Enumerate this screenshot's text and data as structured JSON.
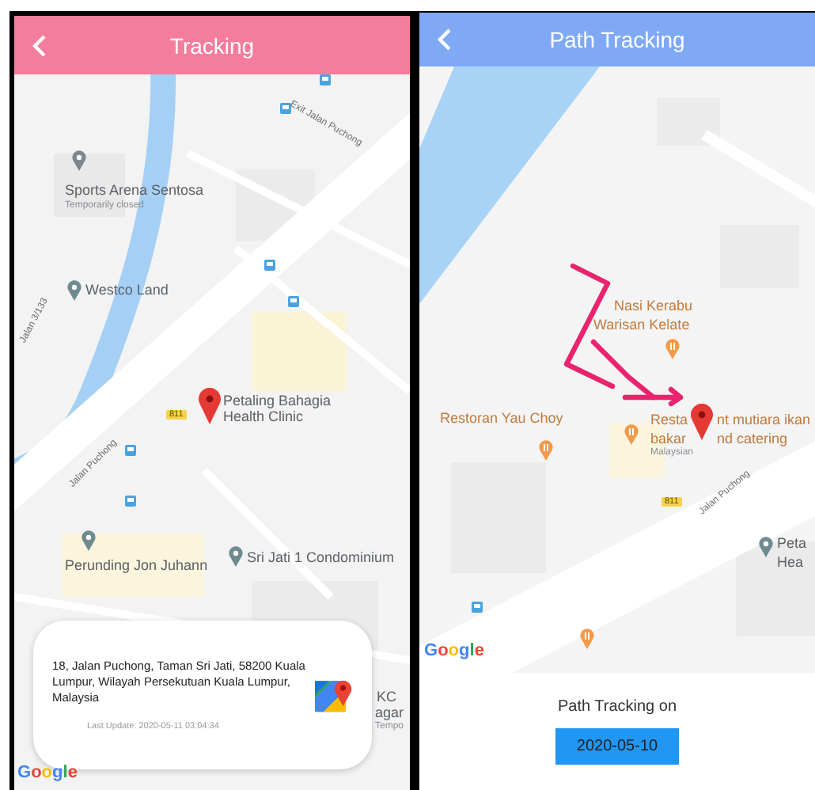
{
  "tracking_screen": {
    "header": {
      "title": "Tracking"
    },
    "map": {
      "labels": [
        {
          "text": "Exit Jalan Puchong",
          "kind": "street"
        },
        {
          "text": "Sports Arena Sentosa",
          "kind": "place"
        },
        {
          "text": "Temporarily closed",
          "kind": "note"
        },
        {
          "text": "Westco Land",
          "kind": "place"
        },
        {
          "text": "Jalan 3/133",
          "kind": "street"
        },
        {
          "text": "811",
          "kind": "shield"
        },
        {
          "text": "Petaling Bahagia Health Clinic",
          "kind": "place"
        },
        {
          "text": "Jalan Puchong",
          "kind": "street"
        },
        {
          "text": "Perunding Jon Juhann",
          "kind": "place"
        },
        {
          "text": "Sri Jati 1 Condominium",
          "kind": "place"
        },
        {
          "text": "KC",
          "kind": "place"
        },
        {
          "text": "agar",
          "kind": "place"
        },
        {
          "text": "Tempo",
          "kind": "note"
        }
      ],
      "attribution": "Google"
    },
    "address_card": {
      "address": "18, Jalan Puchong, Taman Sri Jati, 58200 Kuala Lumpur, Wilayah Persekutuan Kuala Lumpur, Malaysia",
      "last_update": "Last Update: 2020-05-11 03:04:34"
    }
  },
  "path_tracking_screen": {
    "header": {
      "title": "Path Tracking"
    },
    "map": {
      "labels": [
        {
          "text": "Nasi Kerabu",
          "kind": "food"
        },
        {
          "text": "Warisan Kelate",
          "kind": "food"
        },
        {
          "text": "Restoran Yau Choy",
          "kind": "food"
        },
        {
          "text": "Resta",
          "kind": "food"
        },
        {
          "text": "nt mutiara ikan",
          "kind": "food"
        },
        {
          "text": "bakar",
          "kind": "food"
        },
        {
          "text": "nd catering",
          "kind": "food"
        },
        {
          "text": "Malaysian",
          "kind": "note"
        },
        {
          "text": "811",
          "kind": "shield"
        },
        {
          "text": "Jalan Puchong",
          "kind": "street"
        },
        {
          "text": "Peta",
          "kind": "place"
        },
        {
          "text": "Hea",
          "kind": "place"
        }
      ],
      "attribution": "Google"
    },
    "footer": {
      "label": "Path Tracking on",
      "date": "2020-05-10"
    }
  }
}
